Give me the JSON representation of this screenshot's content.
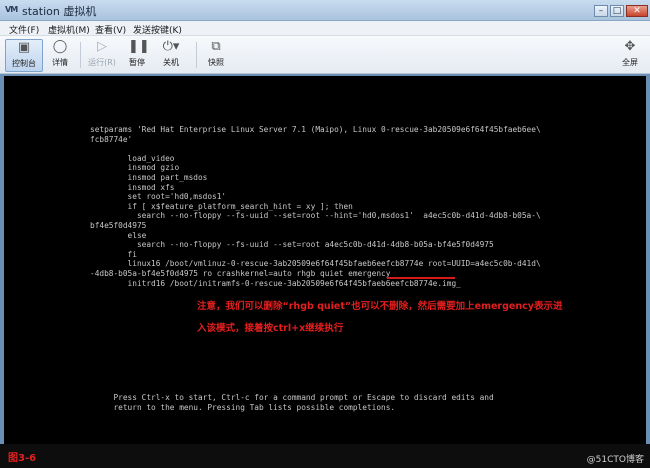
{
  "window": {
    "logo": "VM",
    "title": "station 虚拟机",
    "controls": [
      "–",
      "□",
      "✕"
    ]
  },
  "menubar": {
    "items": [
      "文件(F)",
      "虚拟机(M)",
      "查看(V)",
      "发送按键(K)"
    ]
  },
  "toolbar": {
    "console": "控制台",
    "details": "详情",
    "run": "运行(R)",
    "pause": "暂停",
    "shutdown": "关机",
    "snapshot": "快照",
    "fullscreen": "全屏"
  },
  "terminal": {
    "lines": [
      "setparams 'Red Hat Enterprise Linux Server 7.1 (Maipo), Linux 0-rescue-3ab20509e6f64f45bfaeb6ee\\",
      "fcb8774e'",
      "",
      "        load_video",
      "        insmod gzio",
      "        insmod part_msdos",
      "        insmod xfs",
      "        set root='hd0,msdos1'",
      "        if [ x$feature_platform_search_hint = xy ]; then",
      "          search --no-floppy --fs-uuid --set=root --hint='hd0,msdos1'  a4ec5c0b-d41d-4db8-b05a-\\",
      "bf4e5f0d4975",
      "        else",
      "          search --no-floppy --fs-uuid --set=root a4ec5c0b-d41d-4db8-b05a-bf4e5f0d4975",
      "        fi",
      "        linux16 /boot/vmlinuz-0-rescue-3ab20509e6f64f45bfaeb6eefcb8774e root=UUID=a4ec5c0b-d41d\\",
      "-4db8-b05a-bf4e5f0d4975 ro crashkernel=auto rhgb quiet emergency",
      "        initrd16 /boot/initramfs-0-rescue-3ab20509e6f64f45bfaeb6eefcb8774e.img_"
    ],
    "help_lines": [
      "     Press Ctrl-x to start, Ctrl-c for a command prompt or Escape to discard edits and",
      "     return to the menu. Pressing Tab lists possible completions."
    ]
  },
  "annotation": {
    "line1": "注意，我们可以删除“rhgb quiet”也可以不删除，然后需要加上emergency表示进",
    "line2": "入该模式，接着按ctrl+x继续执行",
    "color": "#e31e1e"
  },
  "footer": {
    "figure_label": "图3-6",
    "watermark": "@51CTO博客"
  }
}
